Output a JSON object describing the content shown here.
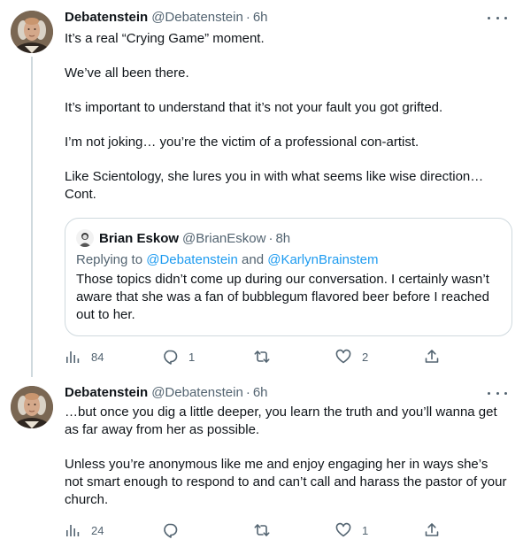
{
  "tweets": [
    {
      "author": {
        "name": "Debatenstein",
        "handle": "@Debatenstein",
        "time": "6h"
      },
      "paragraphs": [
        "It’s a real “Crying Game” moment.",
        "We’ve all been there.",
        "It’s important to understand that it’s not your fault you got grifted.",
        "I’m not joking… you’re the victim of a professional con-artist.",
        "Like Scientology, she lures you in with what seems like wise direction…",
        "Cont."
      ],
      "quote": {
        "author": {
          "name": "Brian Eskow",
          "handle": "@BrianEskow",
          "time": "8h"
        },
        "replying_prefix": "Replying to ",
        "replying_to_1": "@Debatenstein",
        "replying_and": " and ",
        "replying_to_2": "@KarlynBrainstem",
        "text": "Those topics didn’t come up during our conversation. I certainly wasn’t aware that she was a fan of bubblegum flavored beer before I reached out to her."
      },
      "actions": {
        "views": "84",
        "replies": "1",
        "retweets": "",
        "likes": "2"
      }
    },
    {
      "author": {
        "name": "Debatenstein",
        "handle": "@Debatenstein",
        "time": "6h"
      },
      "paragraphs": [
        "…but once you dig a little deeper, you learn the truth and you’ll wanna get as far away from her as possible.",
        "Unless you’re anonymous like me and enjoy engaging her in ways she’s not smart enough to respond to and can’t call and harass the pastor of your church."
      ],
      "actions": {
        "views": "24",
        "replies": "",
        "retweets": "",
        "likes": "1"
      }
    }
  ],
  "colors": {
    "text": "#0f1419",
    "secondary": "#536471",
    "link": "#1d9bf0",
    "border": "#cfd9de"
  },
  "icons": [
    "views-icon",
    "reply-icon",
    "retweet-icon",
    "like-icon",
    "share-icon",
    "more-icon",
    "avatar-portrait"
  ]
}
